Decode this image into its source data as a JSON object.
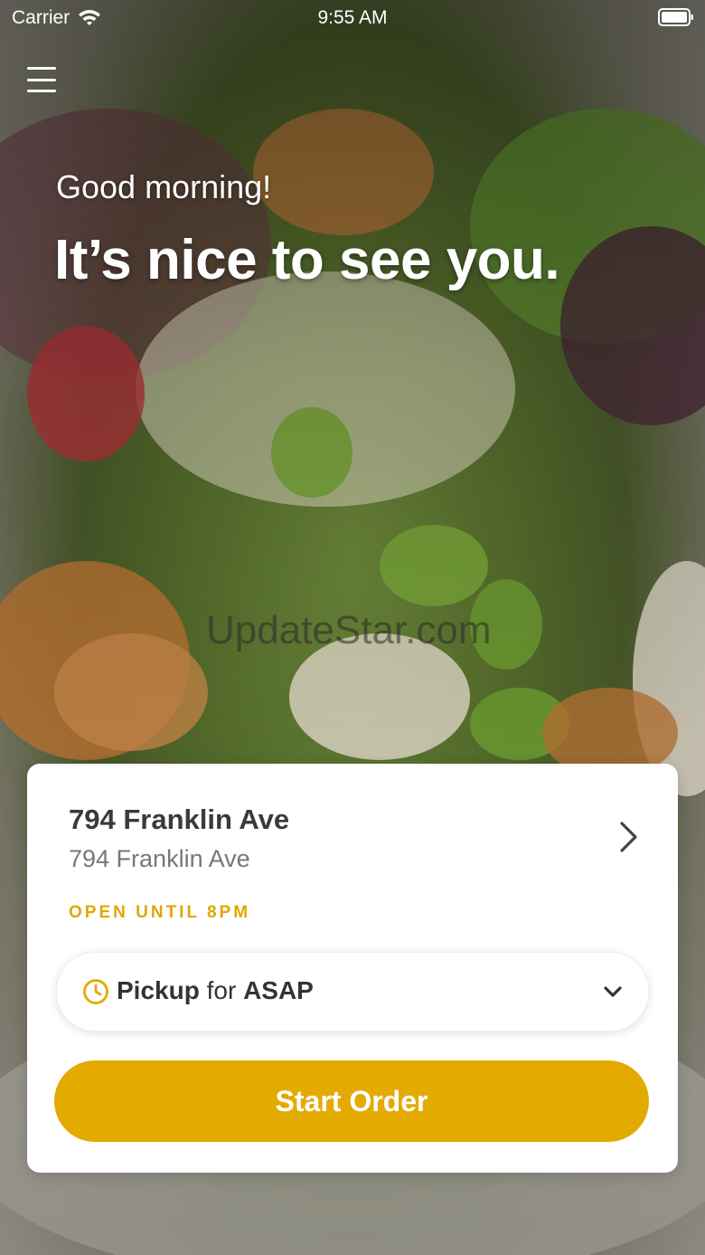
{
  "status_bar": {
    "carrier": "Carrier",
    "time": "9:55 AM"
  },
  "hero": {
    "greeting": "Good morning!",
    "headline": "It’s nice to see you.",
    "watermark": "UpdateStar.com"
  },
  "location_card": {
    "name": "794 Franklin Ave",
    "address": "794 Franklin Ave",
    "hours": "OPEN UNTIL 8PM",
    "order_type": {
      "mode": "Pickup",
      "connector": "for",
      "time": "ASAP"
    },
    "start_button_label": "Start Order"
  },
  "colors": {
    "accent": "#e3aa00",
    "hours_text": "#e0a800"
  },
  "icons": [
    "wifi-icon",
    "battery-icon",
    "hamburger-menu-icon",
    "chevron-right-icon",
    "clock-icon",
    "chevron-down-icon"
  ]
}
